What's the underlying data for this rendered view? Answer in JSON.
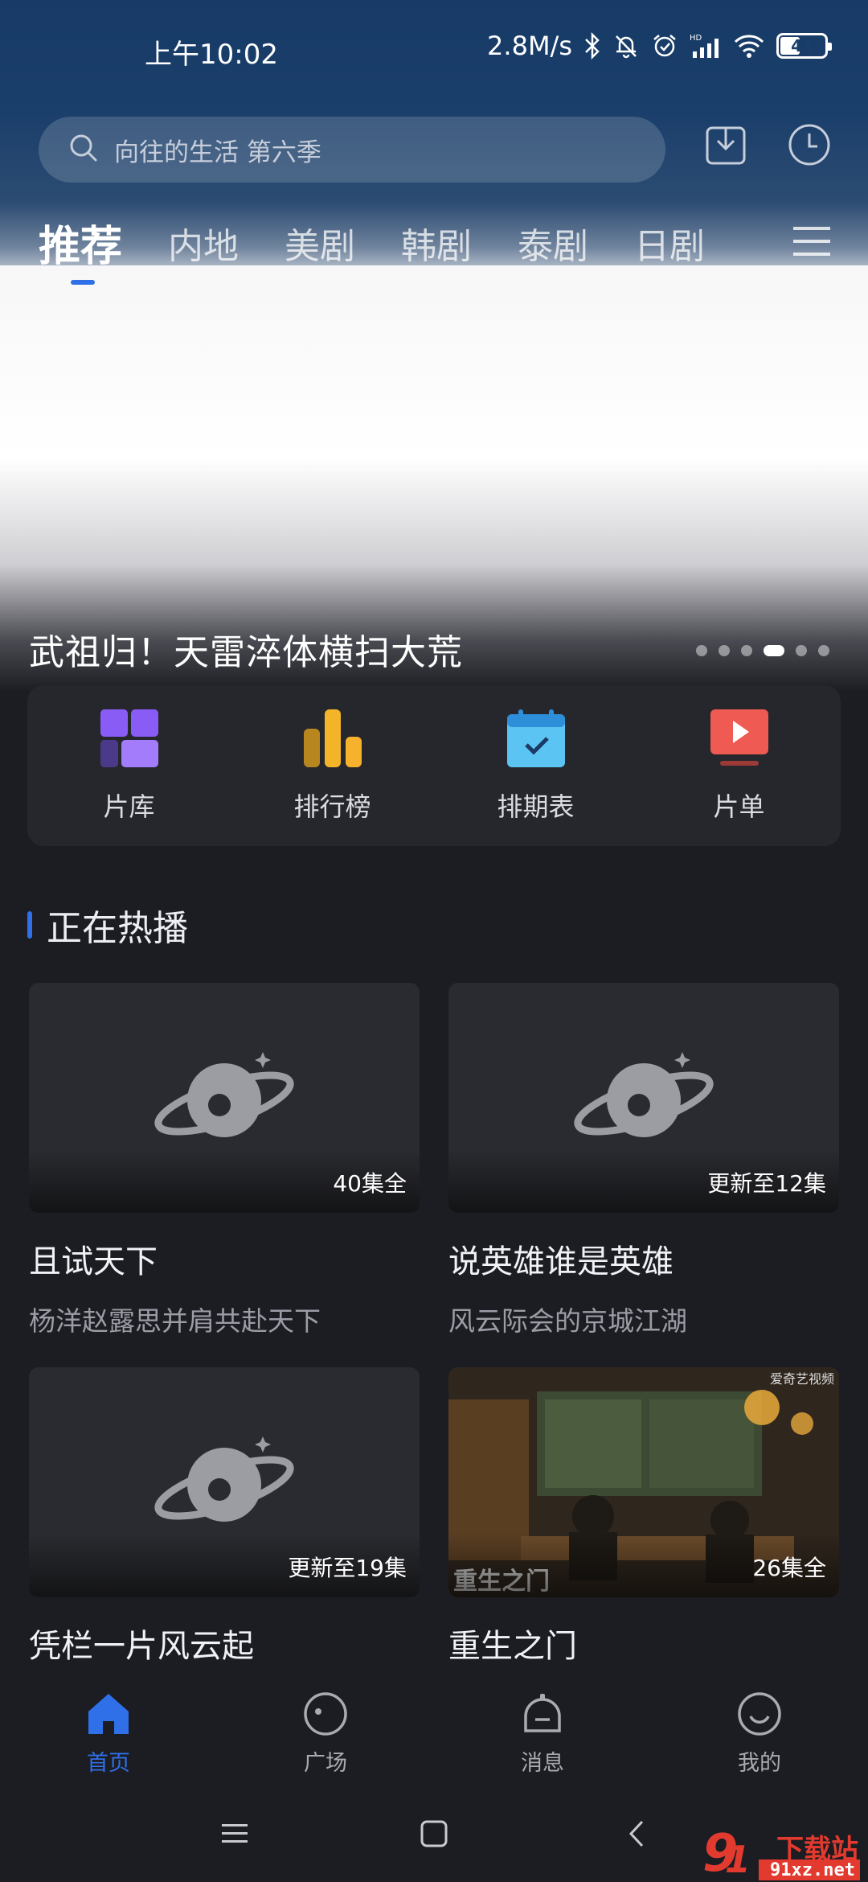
{
  "status_bar": {
    "time": "上午10:02",
    "speed": "2.8M/s",
    "battery": "41"
  },
  "search": {
    "placeholder": "向往的生活 第六季"
  },
  "tabs": [
    {
      "label": "推荐",
      "active": true
    },
    {
      "label": "内地"
    },
    {
      "label": "美剧"
    },
    {
      "label": "韩剧"
    },
    {
      "label": "泰剧"
    },
    {
      "label": "日剧"
    }
  ],
  "banner": {
    "title": "武祖归！天雷淬体横扫大荒",
    "active_dot": 4,
    "dot_count": 6
  },
  "quick": [
    {
      "label": "片库",
      "icon": "library-icon"
    },
    {
      "label": "排行榜",
      "icon": "ranking-icon"
    },
    {
      "label": "排期表",
      "icon": "schedule-icon"
    },
    {
      "label": "片单",
      "icon": "playlist-icon"
    }
  ],
  "section": {
    "title": "正在热播"
  },
  "cards": [
    {
      "title": "且试天下",
      "sub": "杨洋赵露思并肩共赴天下",
      "badge": "40集全"
    },
    {
      "title": "说英雄谁是英雄",
      "sub": "风云际会的京城江湖",
      "badge": "更新至12集"
    },
    {
      "title": "凭栏一片风云起",
      "sub": "",
      "badge": "更新至19集"
    },
    {
      "title": "重生之门",
      "sub": "",
      "badge": "26集全"
    }
  ],
  "bottom_nav": [
    {
      "label": "首页",
      "active": true
    },
    {
      "label": "广场"
    },
    {
      "label": "消息"
    },
    {
      "label": "我的"
    }
  ],
  "watermark": {
    "text_top": "下载站",
    "text_bottom": "91xz.net"
  },
  "colors": {
    "accent": "#2f6fe8",
    "background": "#1c1d22",
    "panel": "#26272d"
  }
}
